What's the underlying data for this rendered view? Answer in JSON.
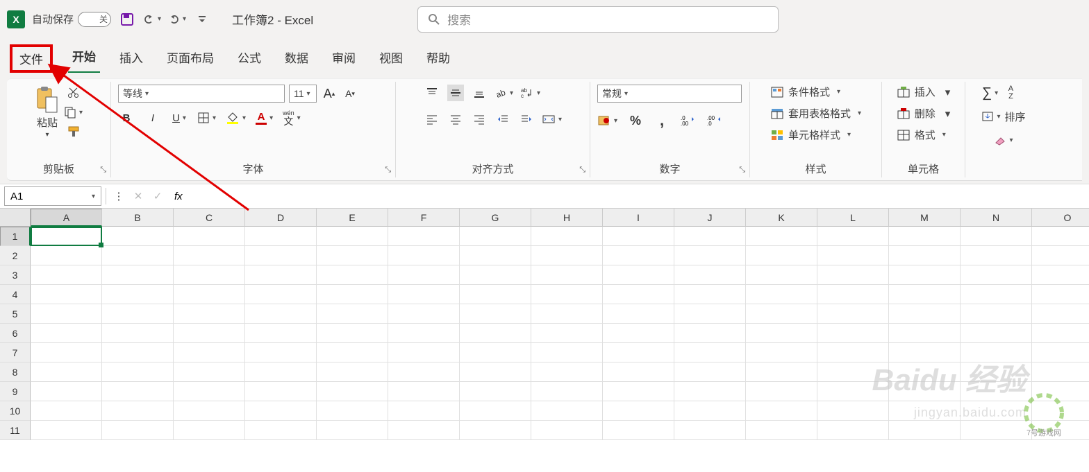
{
  "titlebar": {
    "autosave_label": "自动保存",
    "autosave_state": "关",
    "doc_title": "工作簿2 - Excel",
    "search_placeholder": "搜索"
  },
  "tabs": {
    "file": "文件",
    "home": "开始",
    "insert": "插入",
    "page_layout": "页面布局",
    "formulas": "公式",
    "data": "数据",
    "review": "审阅",
    "view": "视图",
    "help": "帮助"
  },
  "ribbon": {
    "clipboard": {
      "paste": "粘贴",
      "label": "剪贴板"
    },
    "font": {
      "name": "等线",
      "size": "11",
      "label": "字体",
      "wen_label": "wén",
      "wen_sub": "文"
    },
    "alignment": {
      "label": "对齐方式"
    },
    "number": {
      "format": "常规",
      "label": "数字"
    },
    "styles": {
      "conditional": "条件格式",
      "table": "套用表格格式",
      "cell": "单元格样式",
      "label": "样式"
    },
    "cells": {
      "insert": "插入",
      "delete": "删除",
      "format": "格式",
      "label": "单元格"
    },
    "editing": {
      "sort": "排序"
    }
  },
  "formula_bar": {
    "name_box": "A1",
    "fx": "fx"
  },
  "grid": {
    "columns": [
      "A",
      "B",
      "C",
      "D",
      "E",
      "F",
      "G",
      "H",
      "I",
      "J",
      "K",
      "L",
      "M",
      "N",
      "O"
    ],
    "rows": [
      1,
      2,
      3,
      4,
      5,
      6,
      7,
      8,
      9,
      10,
      11
    ],
    "active_cell": "A1"
  },
  "watermark": {
    "brand": "Baidu 经验",
    "url": "jingyan.baidu.com",
    "corner": "7号游戏网"
  }
}
